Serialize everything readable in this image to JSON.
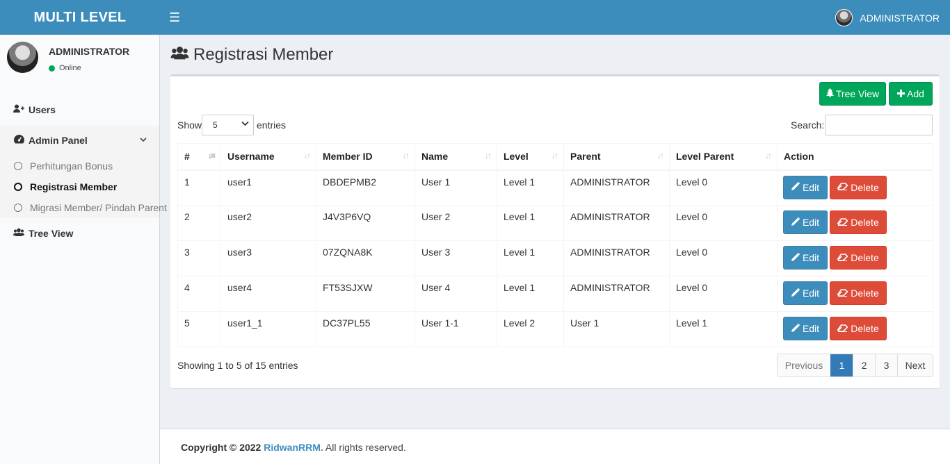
{
  "header": {
    "logo": "MULTI LEVEL",
    "user": "ADMINISTRATOR"
  },
  "sidebar": {
    "user_name": "ADMINISTRATOR",
    "user_status": "Online",
    "menu": {
      "users": "Users",
      "admin_panel": "Admin Panel",
      "sub": [
        "Perhitungan Bonus",
        "Registrasi Member",
        "Migrasi Member/ Pindah Parent"
      ],
      "tree_view": "Tree View"
    }
  },
  "content": {
    "title": "Registrasi Member",
    "tree_view_btn": "Tree View",
    "add_btn": "Add",
    "show": "Show",
    "entries_value": "5",
    "entries": "entries",
    "search_label": "Search:",
    "search_value": "",
    "columns": [
      "#",
      "Username",
      "Member ID",
      "Name",
      "Level",
      "Parent",
      "Level Parent",
      "Action"
    ],
    "rows": [
      [
        "1",
        "user1",
        "DBDEPMB2",
        "User 1",
        "Level 1",
        "ADMINISTRATOR",
        "Level 0"
      ],
      [
        "2",
        "user2",
        "J4V3P6VQ",
        "User 2",
        "Level 1",
        "ADMINISTRATOR",
        "Level 0"
      ],
      [
        "3",
        "user3",
        "07ZQNA8K",
        "User 3",
        "Level 1",
        "ADMINISTRATOR",
        "Level 0"
      ],
      [
        "4",
        "user4",
        "FT53SJXW",
        "User 4",
        "Level 1",
        "ADMINISTRATOR",
        "Level 0"
      ],
      [
        "5",
        "user1_1",
        "DC37PL55",
        "User 1-1",
        "Level 2",
        "User 1",
        "Level 1"
      ]
    ],
    "edit_label": "Edit",
    "delete_label": "Delete",
    "info": "Showing 1 to 5 of 15 entries",
    "pagination": {
      "previous": "Previous",
      "pages": [
        "1",
        "2",
        "3"
      ],
      "next": "Next",
      "active": "1"
    }
  },
  "footer": {
    "prefix": "Copyright © 2022",
    "brand": "RidwanRRM.",
    "suffix": "All rights reserved."
  },
  "colors": {
    "primary": "#3c8dbc",
    "success": "#00a65a",
    "danger": "#dd4b39",
    "online": "#00a65a"
  }
}
